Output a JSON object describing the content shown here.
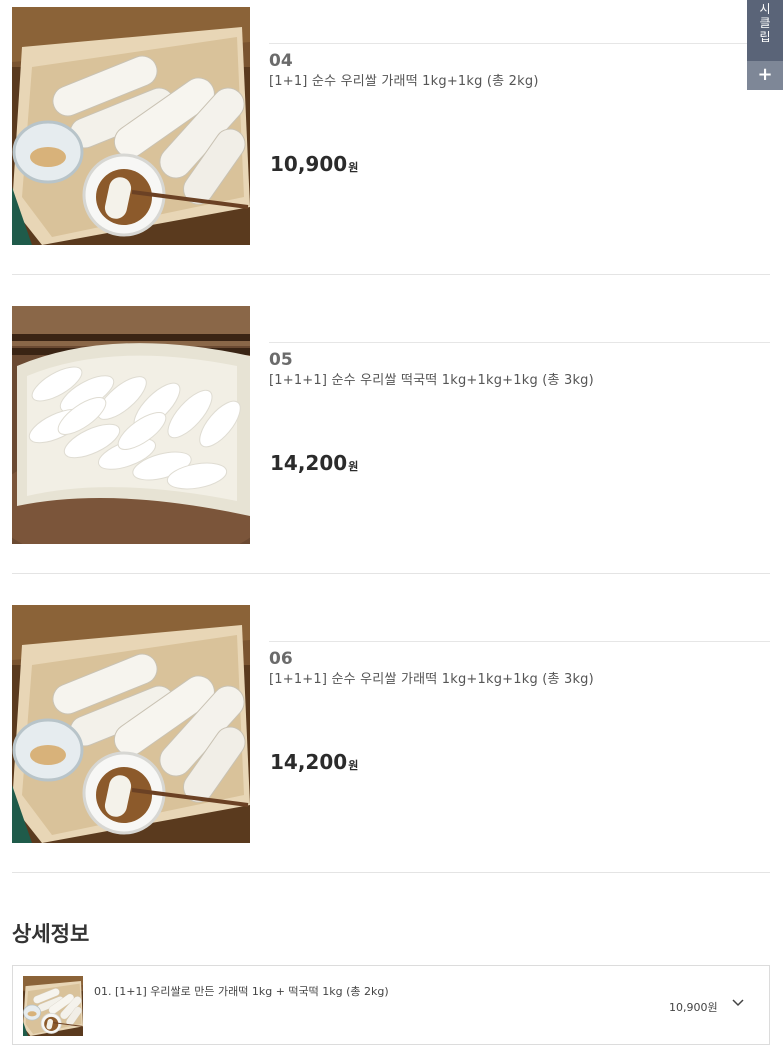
{
  "products": [
    {
      "num": "04",
      "name": "[1+1] 순수 우리쌀 가래떡 1kg+1kg (총 2kg)",
      "price": "10,900",
      "unit": "원",
      "image": "garaetteok-photo"
    },
    {
      "num": "05",
      "name": "[1+1+1] 순수 우리쌀 떡국떡 1kg+1kg+1kg (총 3kg)",
      "price": "14,200",
      "unit": "원",
      "image": "tteokguk-photo"
    },
    {
      "num": "06",
      "name": "[1+1+1] 순수 우리쌀 가래떡 1kg+1kg+1kg (총 3kg)",
      "price": "14,200",
      "unit": "원",
      "image": "garaetteok-photo"
    }
  ],
  "side_tab": {
    "chars": [
      "시",
      "클",
      "립"
    ],
    "plus": "+"
  },
  "detail": {
    "title": "상세정보",
    "item": {
      "name": "01. [1+1] 우리쌀로 만든 가래떡 1kg + 떡국떡 1kg (총 2kg)",
      "price": "10,900원",
      "icon": "chevron-down-icon"
    }
  },
  "colors": {
    "side_tab": "#5a6478",
    "side_plus": "#7e8797",
    "divider": "#e4e4e4"
  }
}
